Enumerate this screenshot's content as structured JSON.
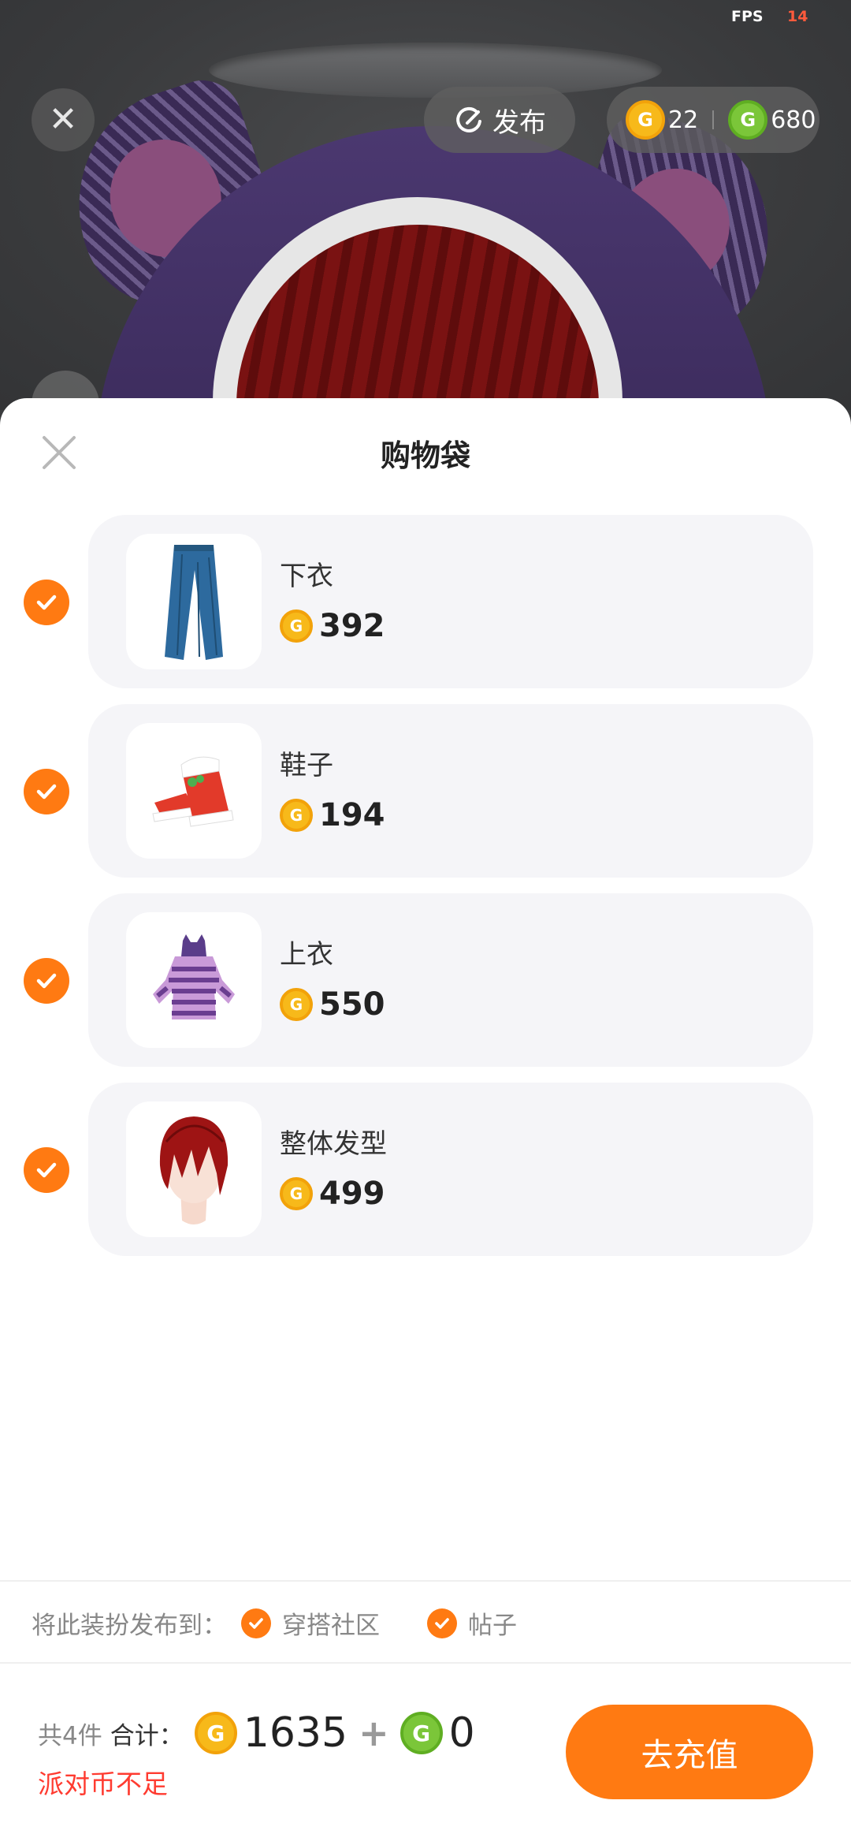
{
  "status": {
    "fps_label": "FPS",
    "fps_value": "14"
  },
  "top_bar": {
    "close_icon": "close-icon",
    "publish_label": "发布",
    "gold_coins": "22",
    "green_coins": "680",
    "coin_gold_glyph": "G",
    "coin_green_glyph": "G"
  },
  "sheet": {
    "title": "购物袋",
    "items": [
      {
        "name": "下衣",
        "price": "392",
        "checked": true,
        "icon": "pants-icon"
      },
      {
        "name": "鞋子",
        "price": "194",
        "checked": true,
        "icon": "shoes-icon"
      },
      {
        "name": "上衣",
        "price": "550",
        "checked": true,
        "icon": "hoodie-icon"
      },
      {
        "name": "整体发型",
        "price": "499",
        "checked": true,
        "icon": "hair-icon"
      }
    ],
    "publish_to": {
      "label": "将此装扮发布到：",
      "options": [
        {
          "label": "穿搭社区",
          "checked": true
        },
        {
          "label": "帖子",
          "checked": true
        }
      ]
    },
    "footer": {
      "count_text": "共4件",
      "sum_label": "合计：",
      "gold_total": "1635",
      "plus": "+",
      "green_total": "0",
      "warning": "派对币不足",
      "recharge_label": "去充值"
    }
  },
  "colors": {
    "accent": "#ff7a12",
    "warning": "#ff3b30",
    "gold_coin": "#f7b91a",
    "green_coin": "#7bc639"
  }
}
